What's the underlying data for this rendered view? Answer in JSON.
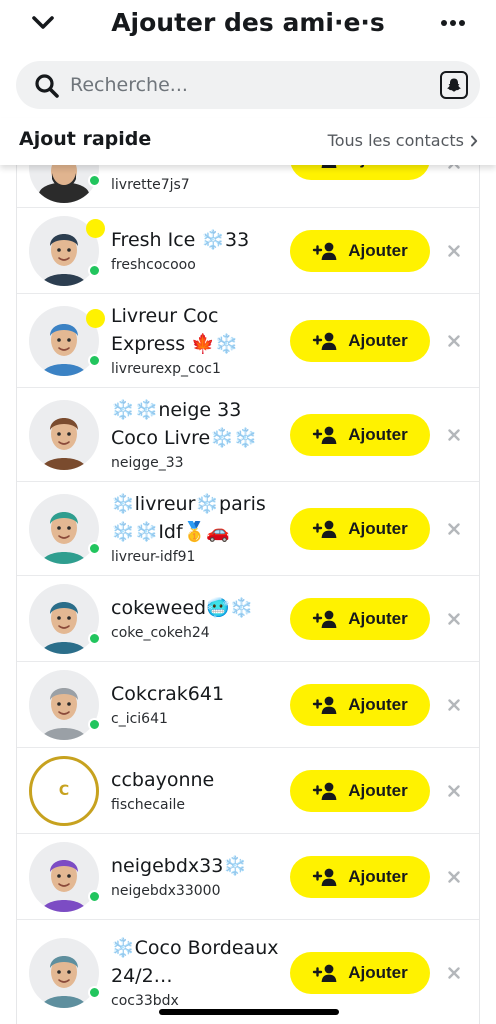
{
  "header": {
    "title": "Ajouter des ami·e·s",
    "back_icon": "chevron-down-icon",
    "more_icon": "more-dots-icon"
  },
  "search": {
    "placeholder": "Recherche...",
    "icon": "search-icon",
    "scan_icon": "snapcode-icon"
  },
  "quick_add": {
    "title": "Ajout rapide",
    "all_contacts_label": "Tous les contacts"
  },
  "colors": {
    "accent_yellow": "#FFF200",
    "online_green": "#22C55E",
    "ring_gold": "#C7A21F"
  },
  "add_button_label": "Ajouter",
  "partial_row": {
    "username": "livrette7js7",
    "button_label": "Ajouter"
  },
  "users": [
    {
      "display_name": "Fresh Ice ❄️33",
      "username": "freshcocooo",
      "button_label": "Ajouter",
      "has_story": true,
      "online": true
    },
    {
      "display_name": "Livreur Coc Express 🍁❄️",
      "username": "livreurexp_coc1",
      "button_label": "Ajouter",
      "has_story": true,
      "online": true
    },
    {
      "display_name": "❄️❄️neige 33 Coco Livre❄️❄️",
      "username": "neigge_33",
      "button_label": "Ajouter",
      "has_story": false,
      "online": false
    },
    {
      "display_name": "❄️livreur❄️paris ❄️❄️Idf🥇🚗",
      "username": "livreur-idf91",
      "button_label": "Ajouter",
      "has_story": false,
      "online": true
    },
    {
      "display_name": "cokeweed🥶❄️",
      "username": "coke_cokeh24",
      "button_label": "Ajouter",
      "has_story": false,
      "online": true
    },
    {
      "display_name": "Cokcrak641",
      "username": "c_ici641",
      "button_label": "Ajouter",
      "has_story": false,
      "online": true
    },
    {
      "display_name": "ccbayonne",
      "username": "fischecaile",
      "button_label": "Ajouter",
      "has_story": false,
      "online": false,
      "initial": "C"
    },
    {
      "display_name": "neigebdx33❄️",
      "username": "neigebdx33000",
      "button_label": "Ajouter",
      "has_story": false,
      "online": true
    },
    {
      "display_name": "❄️Coco Bordeaux 24/2…",
      "username": "coc33bdx",
      "button_label": "Ajouter",
      "has_story": false,
      "online": true
    }
  ]
}
